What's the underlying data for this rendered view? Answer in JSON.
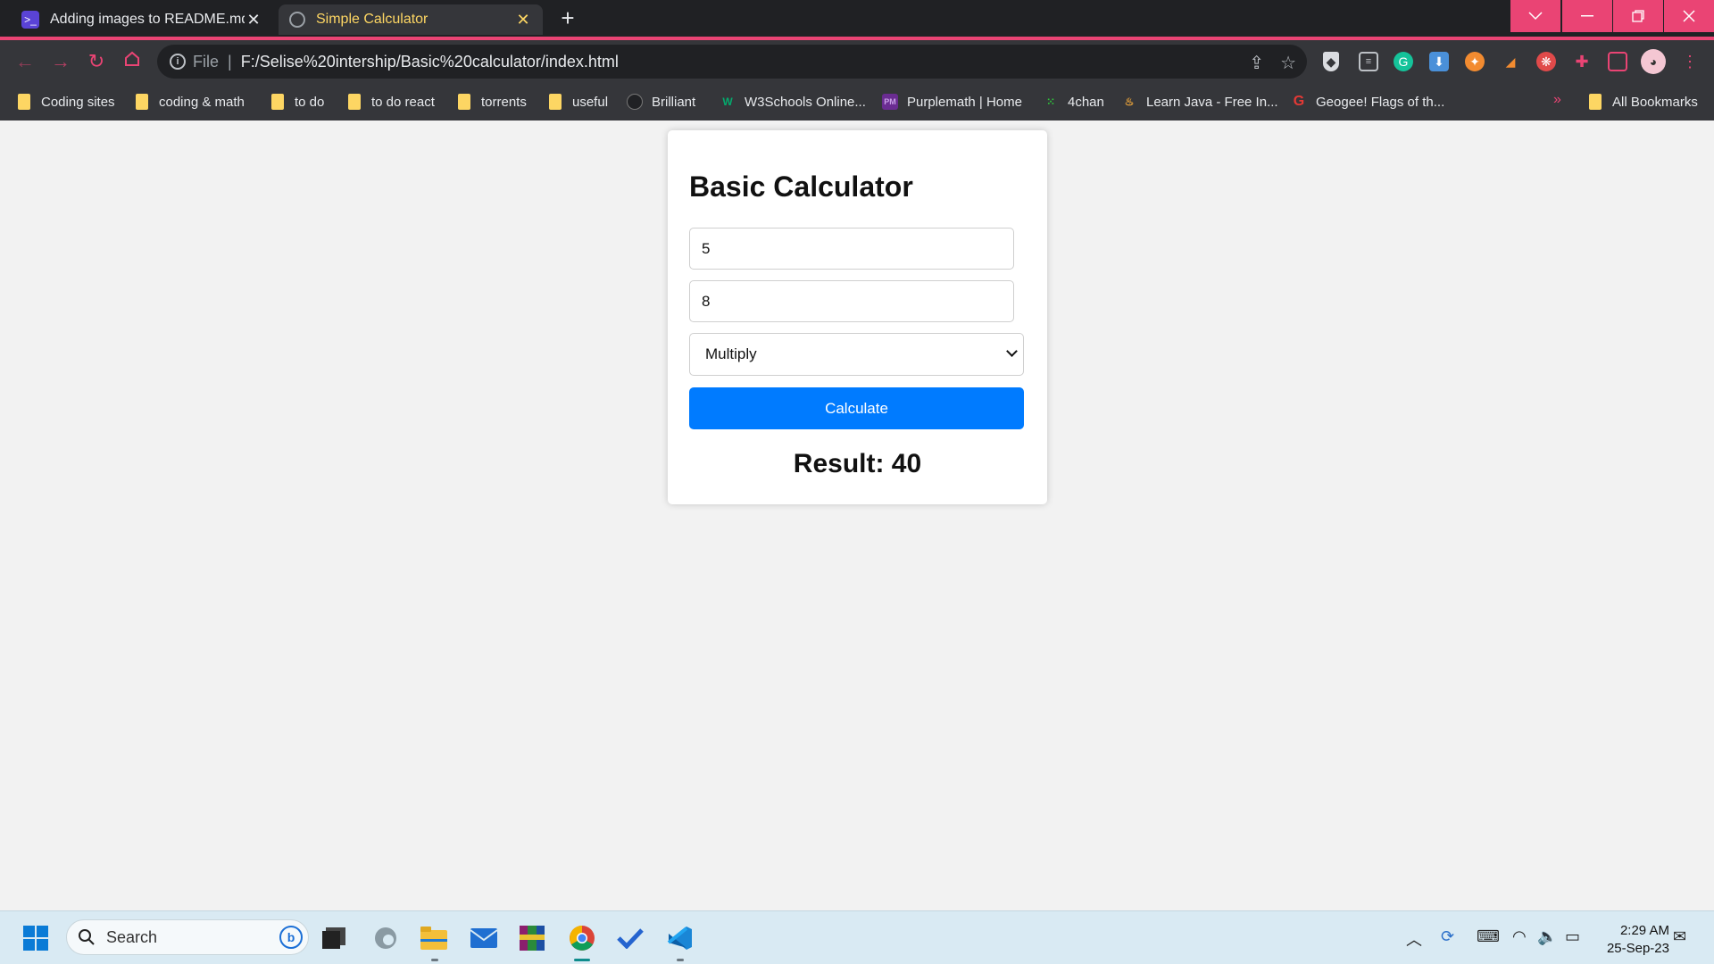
{
  "browser": {
    "tabs": [
      {
        "title": "Adding images to README.md in",
        "close": "✕"
      },
      {
        "title": "Simple Calculator",
        "close": "✕"
      }
    ],
    "new_tab": "+",
    "address": {
      "scheme_label": "File",
      "url": "F:/Selise%20intership/Basic%20calculator/index.html"
    },
    "bookmarks": [
      "Coding sites",
      "coding & math",
      "to do",
      "to do react",
      "torrents",
      "useful",
      "Brilliant",
      "W3Schools Online...",
      "Purplemath | Home",
      "4chan",
      "Learn Java - Free In...",
      "Geogee! Flags of th..."
    ],
    "all_bookmarks": "All Bookmarks",
    "accent_color": "#ea4474"
  },
  "calculator": {
    "heading": "Basic Calculator",
    "first_number": "5",
    "second_number": "8",
    "operation": "Multiply",
    "button_label": "Calculate",
    "result_text": "Result: 40",
    "button_color": "#007bff"
  },
  "taskbar": {
    "search_label": "Search",
    "time": "2:29 AM",
    "date": "25-Sep-23"
  }
}
